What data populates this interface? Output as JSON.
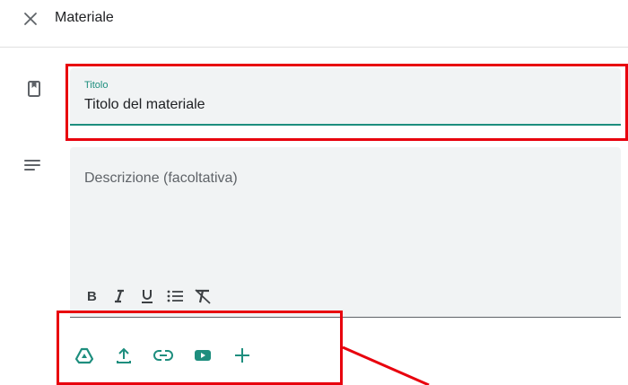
{
  "header": {
    "close_icon": "close-icon",
    "title": "Materiale"
  },
  "title_field": {
    "label": "Titolo",
    "value": "Titolo del materiale",
    "icon": "bookmark-icon"
  },
  "description_field": {
    "placeholder": "Descrizione (facoltativa)",
    "icon": "notes-icon"
  },
  "format_toolbar": [
    {
      "name": "bold",
      "icon": "bold-icon"
    },
    {
      "name": "italic",
      "icon": "italic-icon"
    },
    {
      "name": "underline",
      "icon": "underline-icon"
    },
    {
      "name": "bulleted-list",
      "icon": "list-icon"
    },
    {
      "name": "clear-formatting",
      "icon": "clear-format-icon"
    }
  ],
  "attachments": [
    {
      "name": "google-drive",
      "icon": "drive-icon"
    },
    {
      "name": "upload",
      "icon": "upload-icon"
    },
    {
      "name": "link",
      "icon": "link-icon"
    },
    {
      "name": "youtube",
      "icon": "youtube-icon"
    },
    {
      "name": "create",
      "icon": "plus-icon"
    }
  ],
  "colors": {
    "accent": "#1e8e7e",
    "annotation": "#e8000d",
    "field_background": "#f1f3f4",
    "icon_grey": "#5f6368"
  }
}
